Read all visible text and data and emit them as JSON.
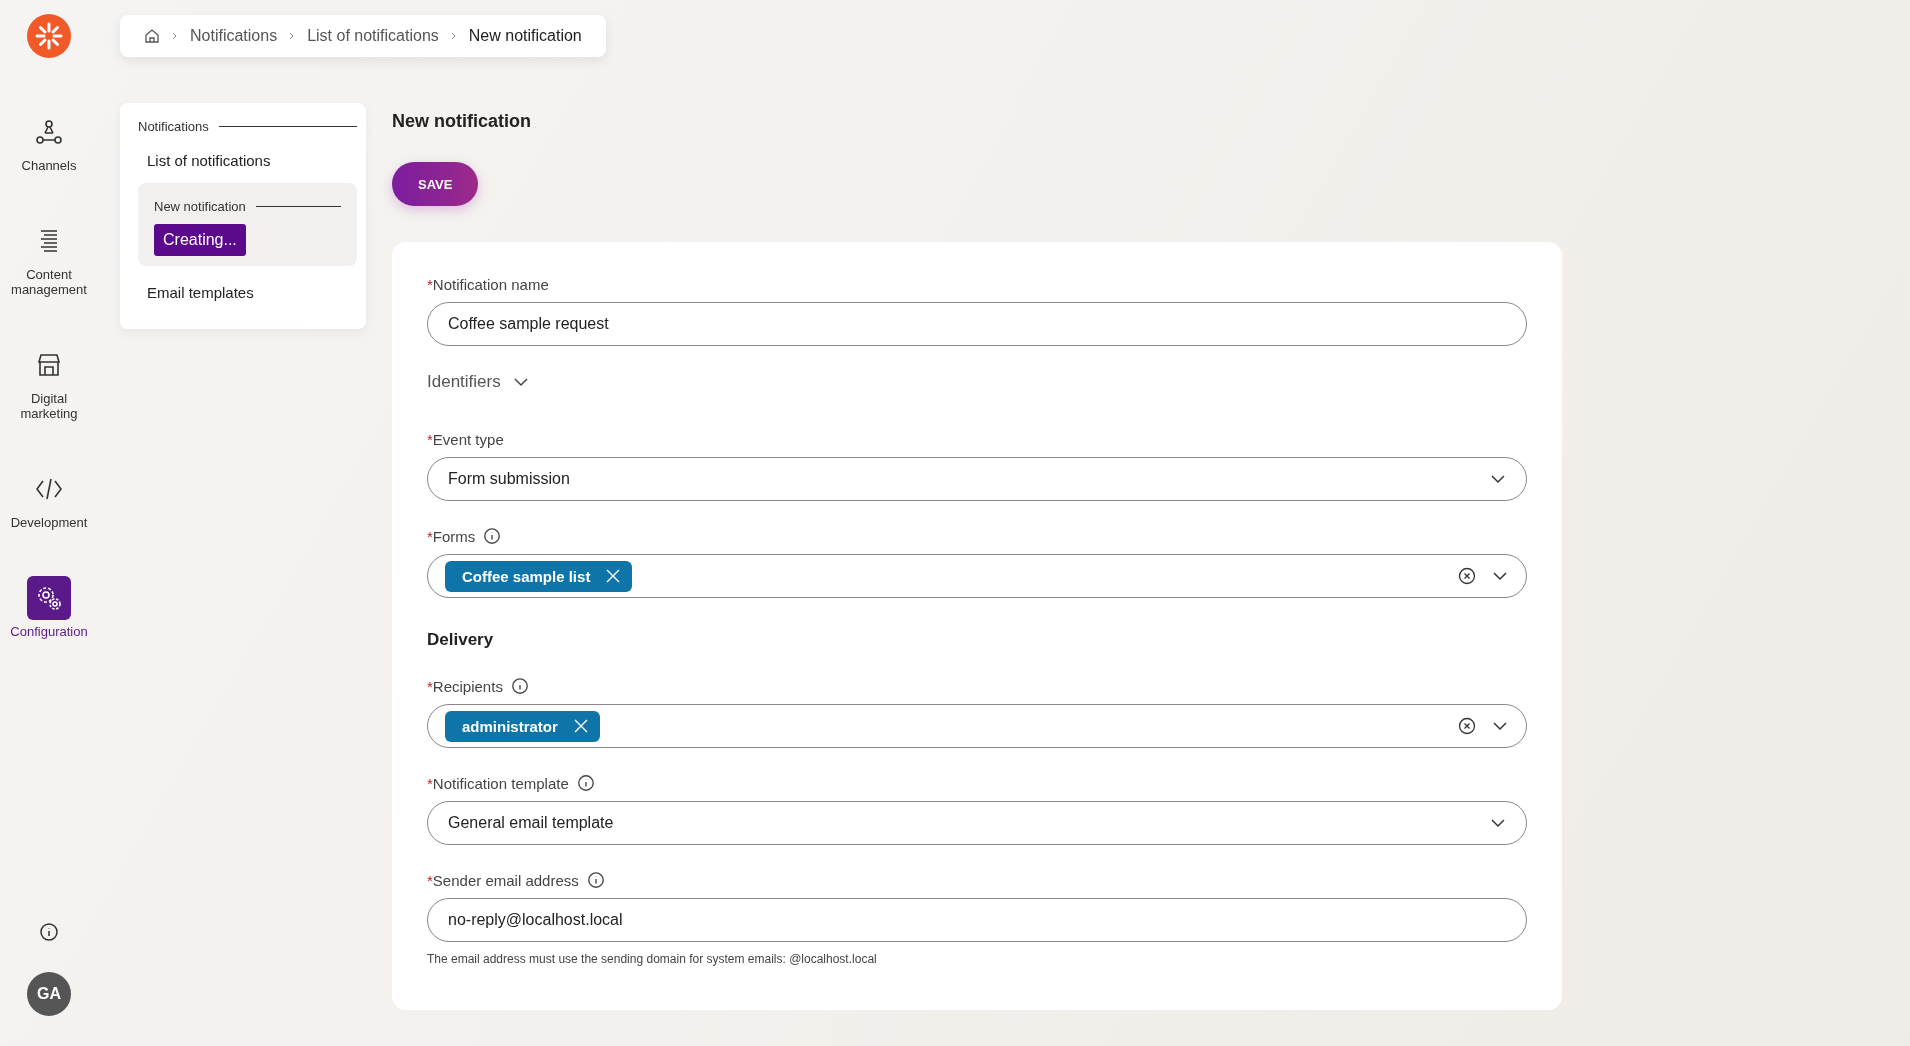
{
  "rail": {
    "items": [
      {
        "label": "Channels",
        "selected": false
      },
      {
        "label": "Content management",
        "selected": false
      },
      {
        "label": "Digital marketing",
        "selected": false
      },
      {
        "label": "Development",
        "selected": false
      },
      {
        "label": "Configuration",
        "selected": true
      }
    ],
    "avatar": "GA"
  },
  "breadcrumb": [
    "Notifications",
    "List of notifications",
    "New notification"
  ],
  "subnav": {
    "heading": "Notifications",
    "items": [
      {
        "kind": "link",
        "label": "List of notifications",
        "selected": false
      },
      {
        "kind": "group",
        "label": "New notification",
        "badge": "Creating...",
        "selected": true
      },
      {
        "kind": "link",
        "label": "Email templates",
        "selected": false
      }
    ]
  },
  "page": {
    "title": "New notification",
    "save": "SAVE"
  },
  "form": [
    {
      "kind": "text",
      "required_mark": "*",
      "label": "Notification name",
      "info": false,
      "value": "Coffee sample request"
    },
    {
      "kind": "toggle",
      "label": "Identifiers",
      "expanded": false
    },
    {
      "kind": "select",
      "required_mark": "*",
      "label": "Event type",
      "info": false,
      "value": "Form submission"
    },
    {
      "kind": "tags",
      "required_mark": "*",
      "label": "Forms",
      "info": true,
      "tags": [
        "Coffee sample list"
      ]
    },
    {
      "kind": "heading",
      "label": "Delivery"
    },
    {
      "kind": "tags",
      "required_mark": "*",
      "label": "Recipients",
      "info": true,
      "tags": [
        "administrator"
      ]
    },
    {
      "kind": "select",
      "required_mark": "*",
      "label": "Notification template",
      "info": true,
      "value": "General email template"
    },
    {
      "kind": "text",
      "required_mark": "*",
      "label": "Sender email address",
      "info": true,
      "value": "no-reply@localhost.local",
      "help": "The email address must use the sending domain for system emails: @localhost.local"
    }
  ]
}
